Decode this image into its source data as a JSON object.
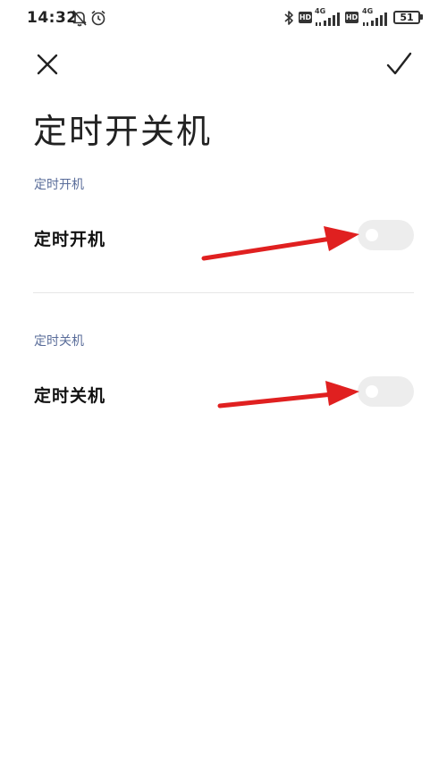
{
  "status_bar": {
    "time": "14:32",
    "icons": [
      "mute-bell-icon",
      "alarm-clock-icon",
      "bluetooth-icon",
      "hd-icon",
      "signal-4g-icon",
      "hd-icon",
      "signal-4g-icon",
      "battery-icon"
    ],
    "hd_label": "HD",
    "network_label": "4G",
    "battery_level": "51"
  },
  "toolbar": {
    "close_icon": "close-icon",
    "confirm_icon": "check-icon"
  },
  "page": {
    "title": "定时开关机"
  },
  "sections": [
    {
      "header": "定时开机",
      "row_label": "定时开机",
      "toggle_on": false
    },
    {
      "header": "定时关机",
      "row_label": "定时关机",
      "toggle_on": false
    }
  ],
  "annotations": {
    "arrow_color": "#e02020"
  },
  "colors": {
    "section_header": "#5a6d9a",
    "toggle_off_track": "#ededed"
  }
}
